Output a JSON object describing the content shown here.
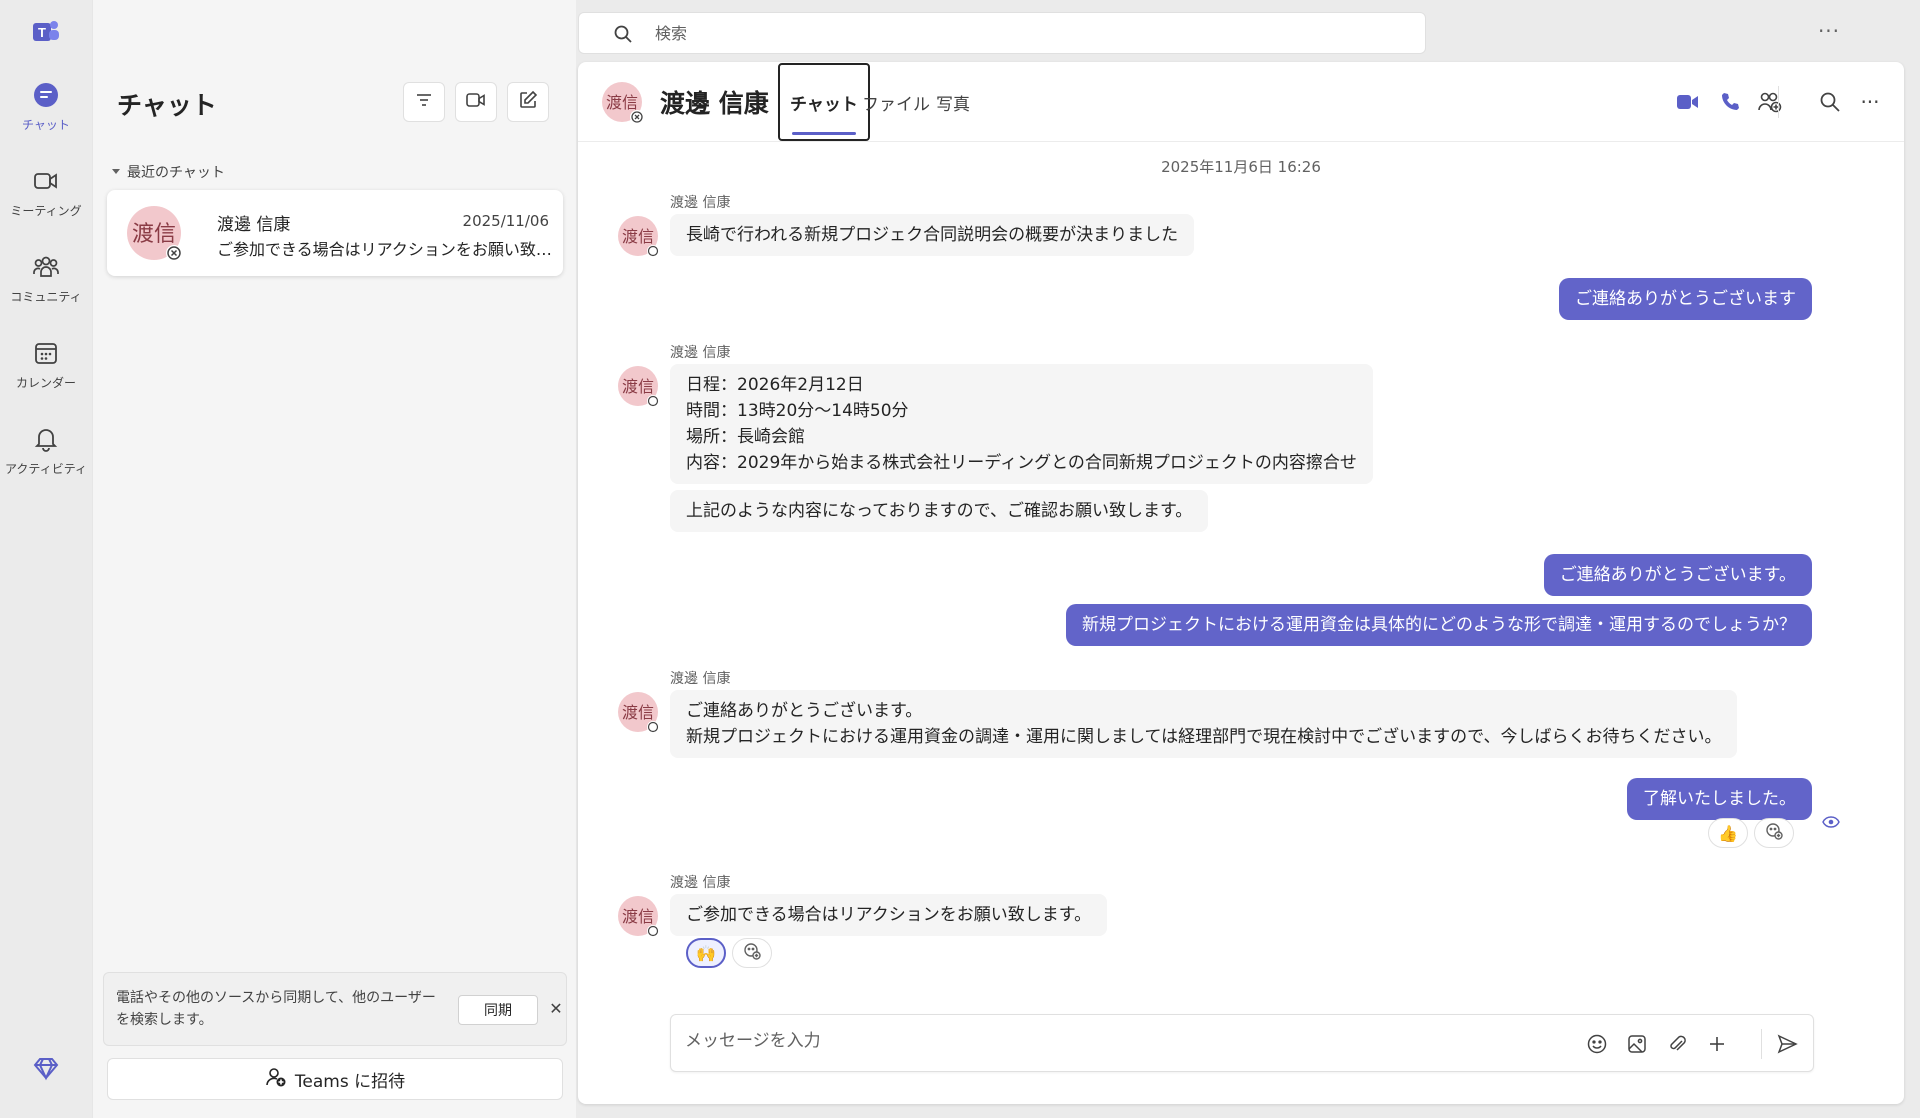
{
  "colors": {
    "brand": "#5b5fc7",
    "outgoing_bubble": "#6264c9",
    "incoming_bubble": "#f5f5f5"
  },
  "rail": {
    "items": [
      {
        "label": "チャット",
        "icon": "chat-icon"
      },
      {
        "label": "ミーティング",
        "icon": "video-icon"
      },
      {
        "label": "コミュニティ",
        "icon": "community-icon"
      },
      {
        "label": "カレンダー",
        "icon": "calendar-icon"
      },
      {
        "label": "アクティビティ",
        "icon": "bell-icon"
      }
    ]
  },
  "search": {
    "placeholder": "検索"
  },
  "chatlist": {
    "title": "チャット",
    "recent_header": "最近のチャット",
    "items": [
      {
        "avatar": "渡信",
        "name": "渡邊 信康",
        "date": "2025/11/06",
        "preview": "ご参加できる場合はリアクションをお願い致します。"
      }
    ],
    "sync_text": "電話やその他のソースから同期して、他のユーザーを検索します。",
    "sync_button": "同期",
    "invite_button": "Teams に招待"
  },
  "conversation": {
    "avatar": "渡信",
    "name": "渡邊 信康",
    "tabs": [
      "チャット",
      "ファイル",
      "写真"
    ],
    "date": "2025年11月6日 16:26",
    "messages": [
      {
        "sender": "渡邊 信康",
        "lines": [
          "長崎で行われる新規プロジェク合同説明会の概要が決まりました"
        ]
      },
      {
        "out": "ご連絡ありがとうございます"
      },
      {
        "sender": "渡邊 信康",
        "lines": [
          "日程：2026年2月12日",
          "時間：13時20分～14時50分",
          "場所：長崎会館",
          "内容：2029年から始まる株式会社リーディングとの合同新規プロジェクトの内容擦合せ"
        ]
      },
      {
        "lines": [
          "上記のような内容になっておりますので、ご確認お願い致します。"
        ]
      },
      {
        "out": "ご連絡ありがとうございます。"
      },
      {
        "out": "新規プロジェクトにおける運用資金は具体的にどのような形で調達・運用するのでしょうか？"
      },
      {
        "sender": "渡邊 信康",
        "lines": [
          "ご連絡ありがとうございます。",
          "新規プロジェクトにおける運用資金の調達・運用に関しましては経理部門で現在検討中でございますので、今しばらくお待ちください。"
        ]
      },
      {
        "out": "了解いたしました。",
        "reaction": "👍"
      },
      {
        "sender": "渡邊 信康",
        "lines": [
          "ご参加できる場合はリアクションをお願い致します。"
        ],
        "reaction": "🙌"
      }
    ]
  },
  "compose": {
    "placeholder": "メッセージを入力"
  }
}
